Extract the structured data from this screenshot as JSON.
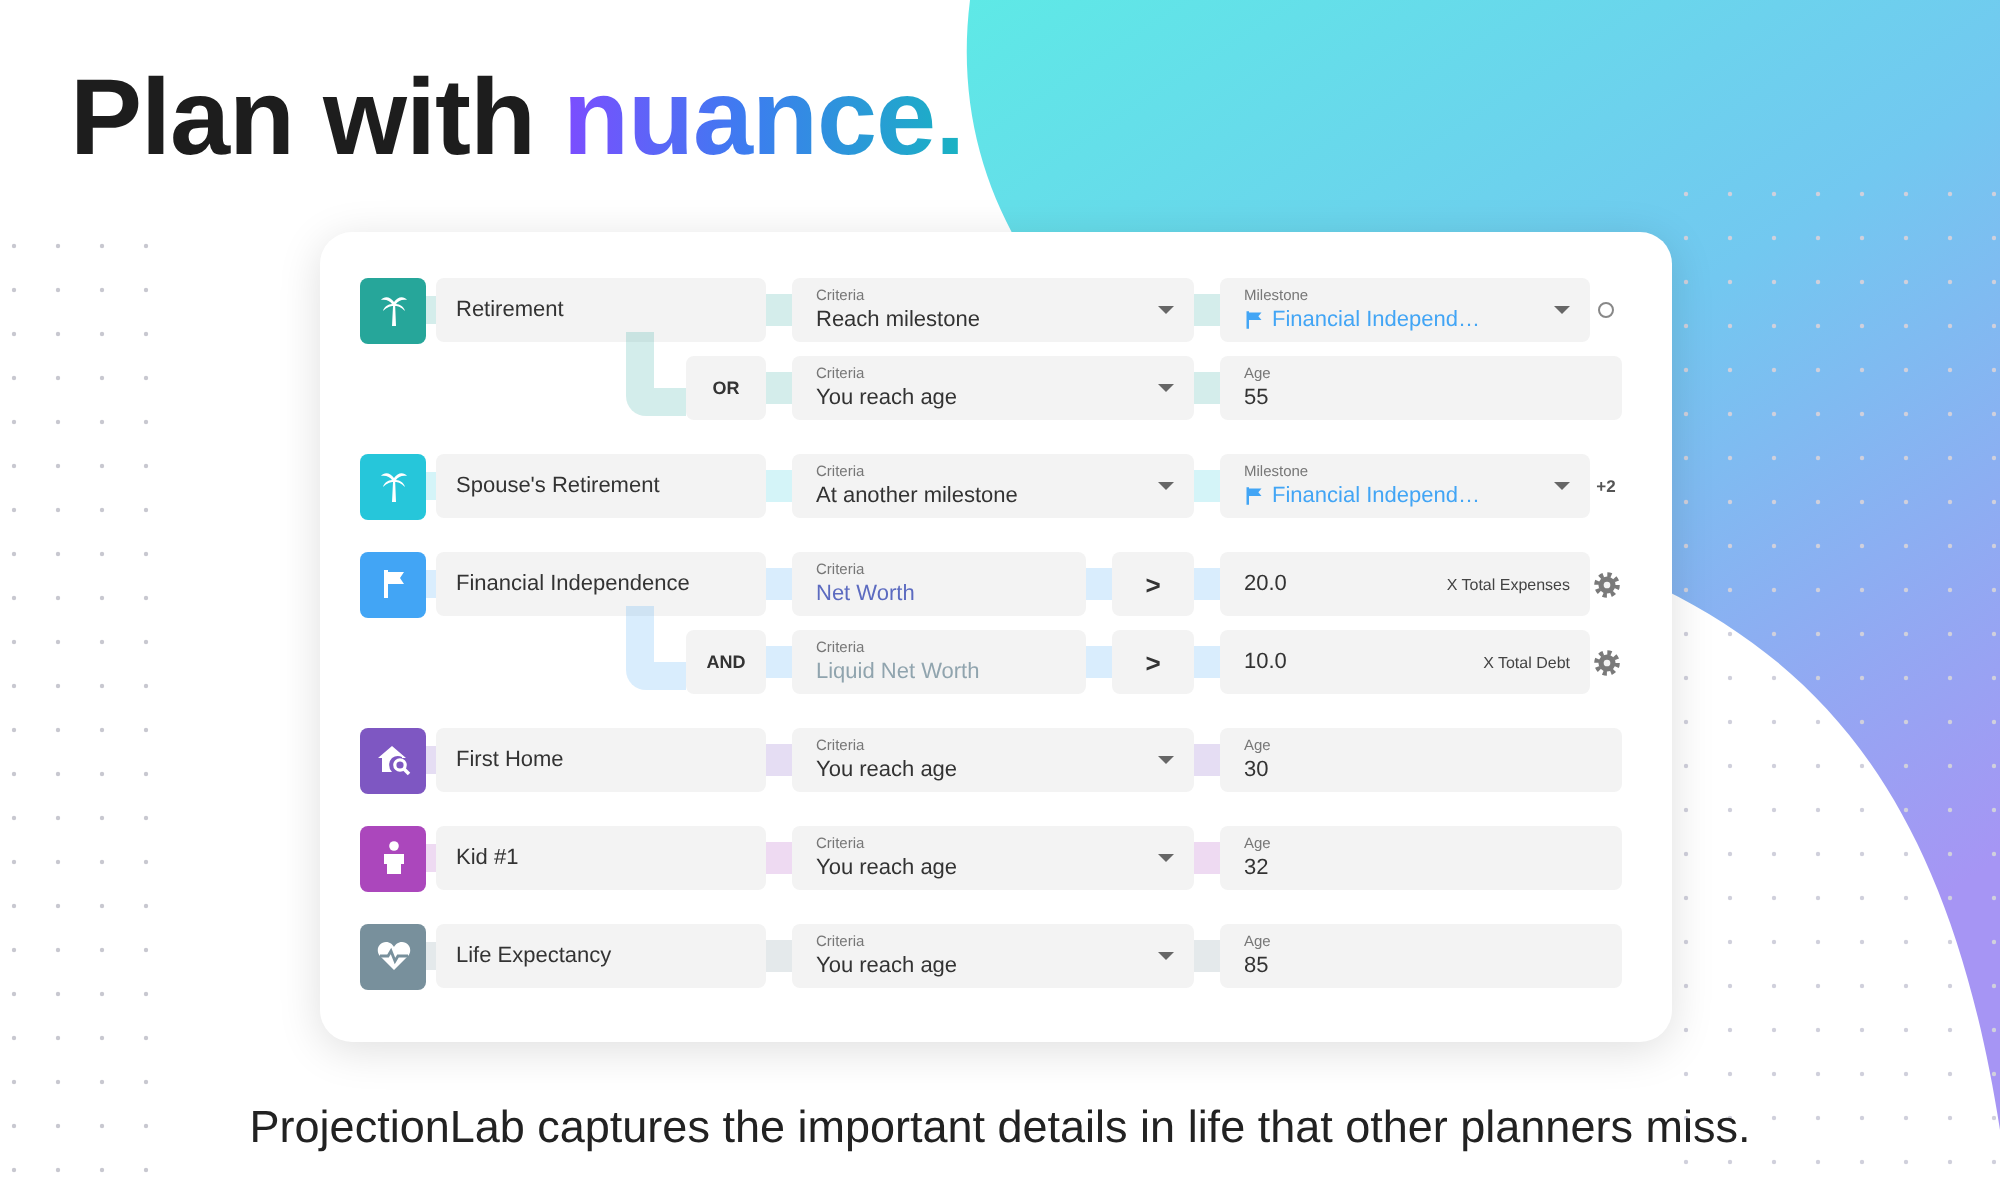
{
  "headline": {
    "text": "Plan with",
    "highlight": "nuance."
  },
  "milestones": [
    {
      "name": "Retirement",
      "kind": "palm",
      "color": "#26a69a",
      "conditions": [
        {
          "criteria": {
            "label": "Criteria",
            "value": "Reach milestone",
            "kind": "plain",
            "dropdown": true
          },
          "target": {
            "kind": "milestone",
            "label": "Milestone",
            "value": "Financial Independ…",
            "dropdown": true
          },
          "trailing": {
            "kind": "circle"
          }
        },
        {
          "conjunction": "OR",
          "criteria": {
            "label": "Criteria",
            "value": "You reach age",
            "kind": "plain",
            "dropdown": true
          },
          "target": {
            "kind": "age",
            "label": "Age",
            "value": "55"
          }
        }
      ]
    },
    {
      "name": "Spouse's Retirement",
      "kind": "palm",
      "color": "#26c6da",
      "conditions": [
        {
          "criteria": {
            "label": "Criteria",
            "value": "At another milestone",
            "kind": "plain",
            "dropdown": true
          },
          "target": {
            "kind": "milestone",
            "label": "Milestone",
            "value": "Financial Independ…",
            "dropdown": true
          },
          "trailing": {
            "kind": "count",
            "text": "+2"
          }
        }
      ]
    },
    {
      "name": "Financial Independence",
      "kind": "flag",
      "color": "#42a5f5",
      "conditions": [
        {
          "criteria": {
            "label": "Criteria",
            "value": "Net Worth",
            "kind": "accent",
            "dropdown": false
          },
          "operator": ">",
          "target": {
            "kind": "multiplier",
            "value": "20.0",
            "suffix": "X Total Expenses"
          },
          "trailing": {
            "kind": "gear"
          }
        },
        {
          "conjunction": "AND",
          "criteria": {
            "label": "Criteria",
            "value": "Liquid Net Worth",
            "kind": "muted",
            "dropdown": false
          },
          "operator": ">",
          "target": {
            "kind": "multiplier",
            "value": "10.0",
            "suffix": "X Total Debt"
          },
          "trailing": {
            "kind": "gear"
          }
        }
      ]
    },
    {
      "name": "First Home",
      "kind": "home",
      "color": "#7e57c2",
      "conditions": [
        {
          "criteria": {
            "label": "Criteria",
            "value": "You reach age",
            "kind": "plain",
            "dropdown": true
          },
          "target": {
            "kind": "age",
            "label": "Age",
            "value": "30"
          }
        }
      ]
    },
    {
      "name": "Kid #1",
      "kind": "person",
      "color": "#ab47bc",
      "conditions": [
        {
          "criteria": {
            "label": "Criteria",
            "value": "You reach age",
            "kind": "plain",
            "dropdown": true
          },
          "target": {
            "kind": "age",
            "label": "Age",
            "value": "32"
          }
        }
      ]
    },
    {
      "name": "Life Expectancy",
      "kind": "heart",
      "color": "#78909c",
      "conditions": [
        {
          "criteria": {
            "label": "Criteria",
            "value": "You reach age",
            "kind": "plain",
            "dropdown": true
          },
          "target": {
            "kind": "age",
            "label": "Age",
            "value": "85"
          }
        }
      ]
    }
  ],
  "caption": "ProjectionLab captures the important details in life that other planners miss."
}
